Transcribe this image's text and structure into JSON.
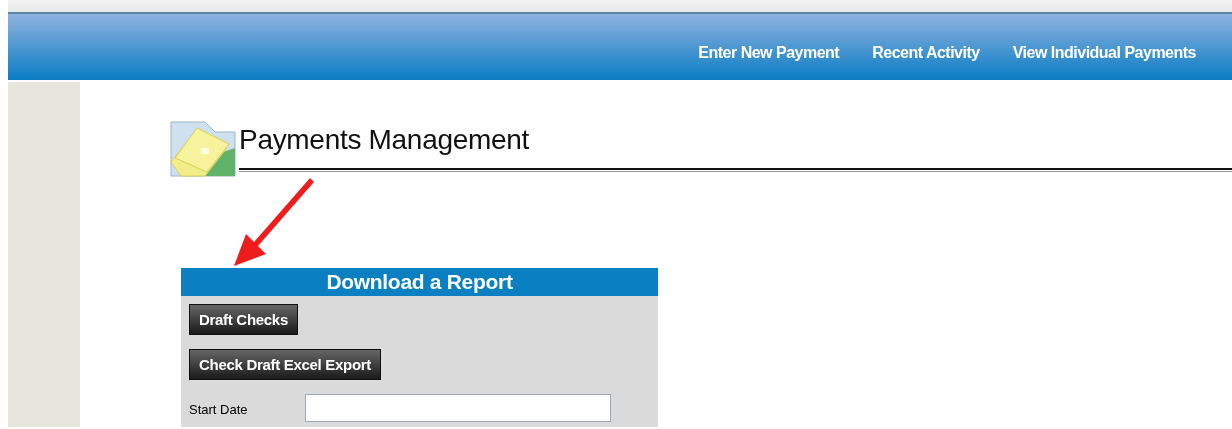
{
  "nav": {
    "links": [
      {
        "label": "Enter New Payment"
      },
      {
        "label": "Recent Activity"
      },
      {
        "label": "View Individual Payments"
      }
    ]
  },
  "page_title": "Payments Management",
  "report_panel": {
    "title": "Download a Report",
    "buttons": [
      {
        "label": "Draft Checks"
      },
      {
        "label": "Check Draft Excel Export"
      }
    ],
    "fields": [
      {
        "label": "Start Date"
      }
    ]
  }
}
